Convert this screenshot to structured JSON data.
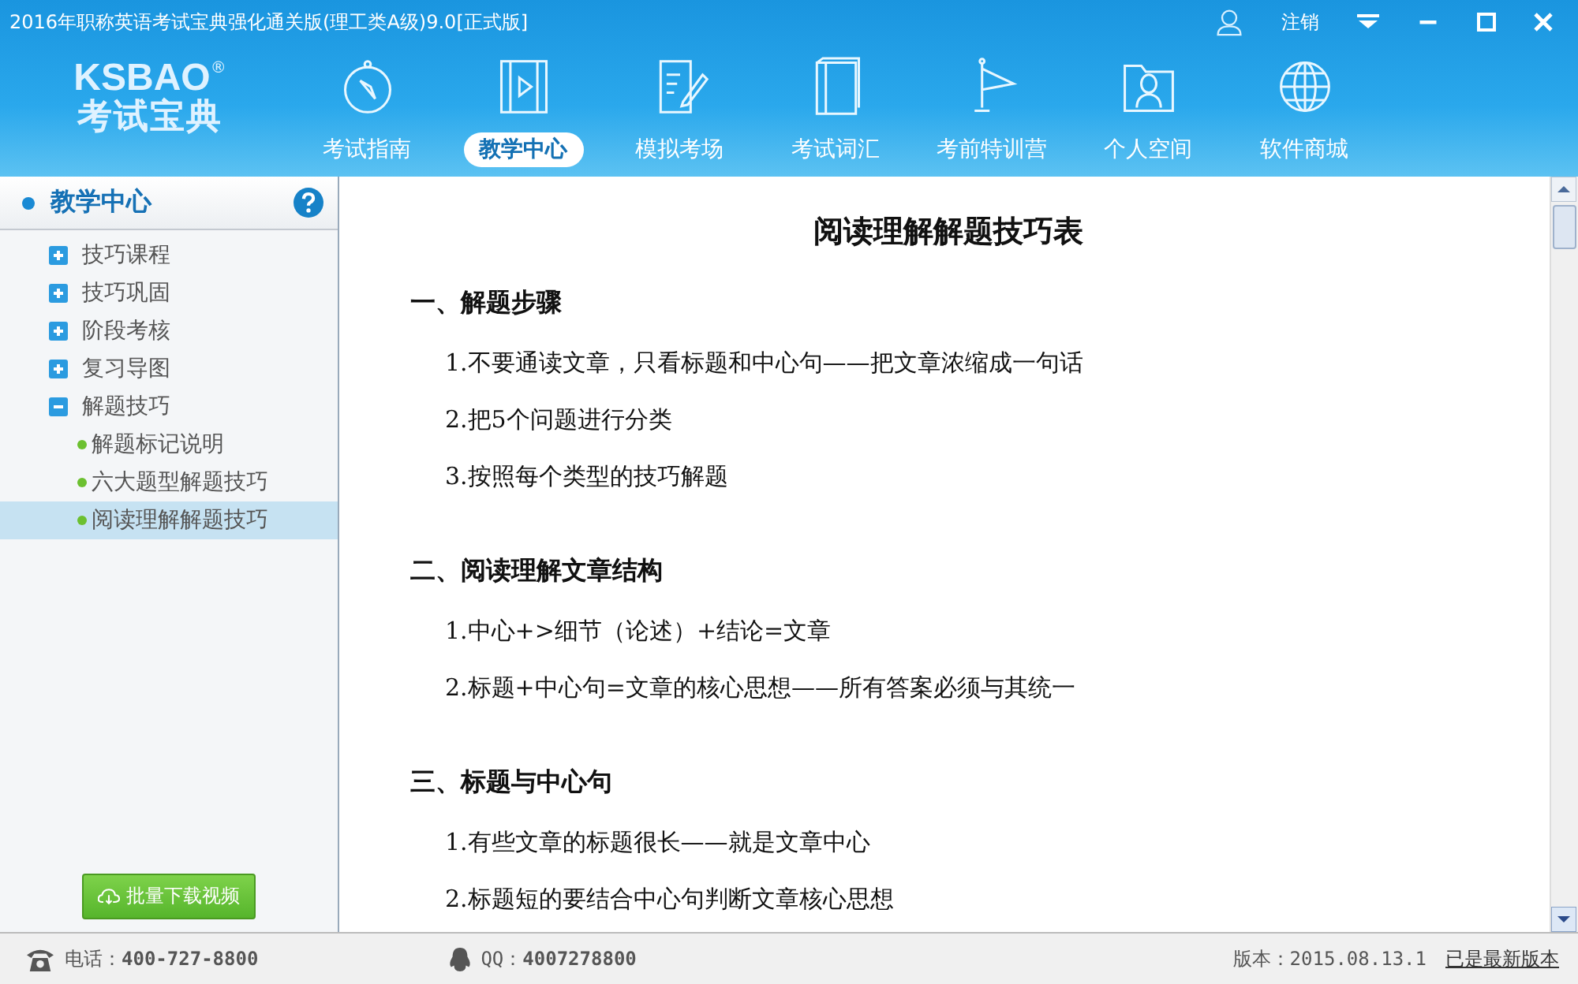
{
  "window": {
    "title": "2016年职称英语考试宝典强化通关版(理工类A级)9.0[正式版]",
    "logout": "注销"
  },
  "logo": {
    "latin": "KSBAO",
    "registered": "®",
    "chinese": "考试宝典"
  },
  "nav": [
    {
      "label": "考试指南",
      "selected": false
    },
    {
      "label": "教学中心",
      "selected": true
    },
    {
      "label": "模拟考场",
      "selected": false
    },
    {
      "label": "考试词汇",
      "selected": false
    },
    {
      "label": "考前特训营",
      "selected": false
    },
    {
      "label": "个人空间",
      "selected": false
    },
    {
      "label": "软件商城",
      "selected": false
    }
  ],
  "sidebar": {
    "title": "教学中心",
    "items": [
      {
        "label": "技巧课程",
        "expanded": false
      },
      {
        "label": "技巧巩固",
        "expanded": false
      },
      {
        "label": "阶段考核",
        "expanded": false
      },
      {
        "label": "复习导图",
        "expanded": false
      },
      {
        "label": "解题技巧",
        "expanded": true,
        "children": [
          {
            "label": "解题标记说明",
            "selected": false
          },
          {
            "label": "六大题型解题技巧",
            "selected": false
          },
          {
            "label": "阅读理解解题技巧",
            "selected": true
          }
        ]
      }
    ],
    "download_button": "批量下载视频"
  },
  "document": {
    "title": "阅读理解解题技巧表",
    "sections": [
      {
        "heading": "一、解题步骤",
        "items": [
          "1.不要通读文章，只看标题和中心句——把文章浓缩成一句话",
          "2.把5个问题进行分类",
          "3.按照每个类型的技巧解题"
        ]
      },
      {
        "heading": "二、阅读理解文章结构",
        "items": [
          "1.中心+>细节（论述）+结论=文章",
          "2.标题+中心句=文章的核心思想——所有答案必须与其统一"
        ]
      },
      {
        "heading": "三、标题与中心句",
        "items": [
          "1.有些文章的标题很长——就是文章中心",
          "2.标题短的要结合中心句判断文章核心思想"
        ]
      }
    ]
  },
  "status_bar": {
    "phone_label": "电话：",
    "phone": "400-727-8800",
    "qq_label": "QQ：",
    "qq": "4007278800",
    "version": "版本：2015.08.13.1",
    "update": "已是最新版本"
  }
}
